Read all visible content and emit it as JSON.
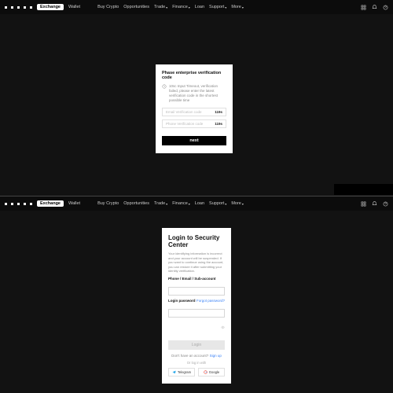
{
  "nav": {
    "pill": "Exchange",
    "wallet": "Wallet",
    "items": [
      "Buy Crypto",
      "Opportunities",
      "Trade",
      "Finance",
      "Loan",
      "Support",
      "More"
    ],
    "has_caret": [
      false,
      false,
      true,
      true,
      false,
      true,
      true
    ]
  },
  "modal1": {
    "title": "Phase enterprise verification code",
    "warning": "10sc Input Timeout, verification failed, please enter the latest verification code in the shortest possible time",
    "email_ph": "Email Verification code",
    "phone_ph": "Phone Verification code",
    "timer": "119s",
    "next": "next"
  },
  "modal2": {
    "title": "Login to Security Center",
    "desc": "Your identifying information is incorrect and your account will be suspended. If you want to continue using the account, you can restore it after submitting your identity verification.",
    "field1_label": "Phone / Email / Sub-account",
    "field2_label": "Login password",
    "forgot": "Forgot password?",
    "login": "Login",
    "no_account": "Don't have an account?",
    "signup": "Sign up",
    "or": "Or log in with",
    "telegram": "Telegram",
    "google": "Google"
  }
}
